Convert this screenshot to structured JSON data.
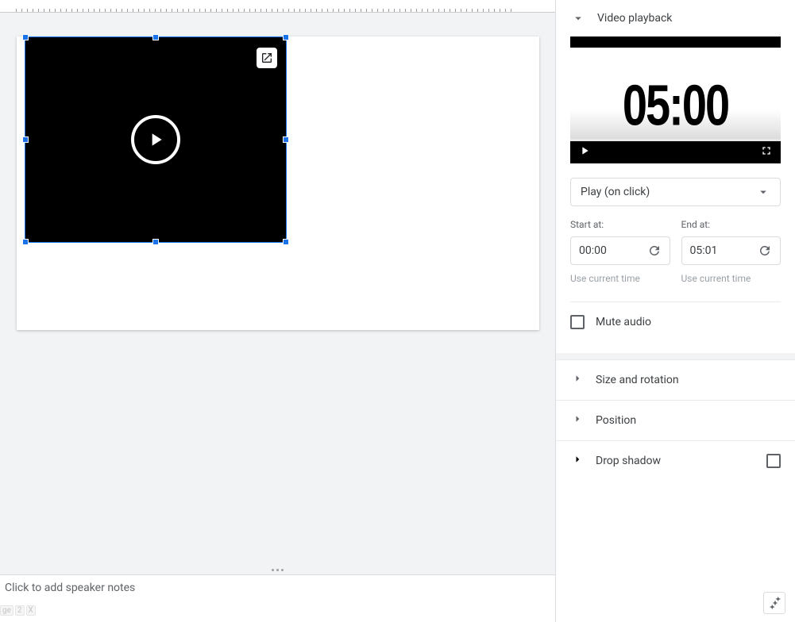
{
  "notes_placeholder": "Click to add speaker notes",
  "sidebar": {
    "playback_header": "Video playback",
    "preview_time": "05:00",
    "play_mode": "Play (on click)",
    "start_label": "Start at:",
    "end_label": "End at:",
    "start_value": "00:00",
    "end_value": "05:01",
    "use_current_time": "Use current time",
    "mute_audio": "Mute audio",
    "size_rotation": "Size and rotation",
    "position": "Position",
    "drop_shadow": "Drop shadow"
  }
}
